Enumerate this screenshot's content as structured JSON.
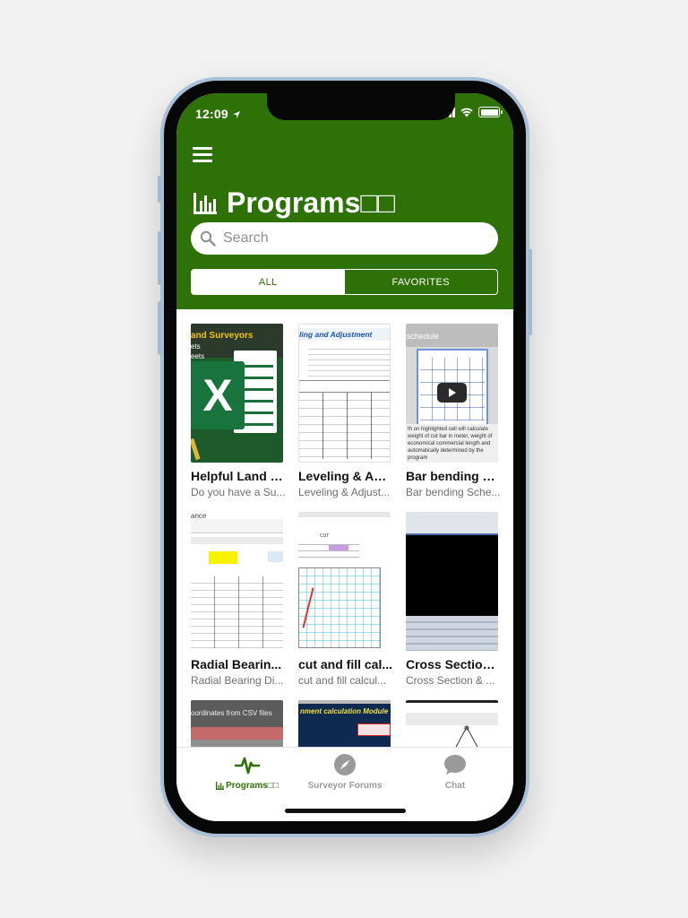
{
  "status": {
    "time": "12:09"
  },
  "header": {
    "title": "Programs□□",
    "search_placeholder": "Search",
    "segments": {
      "all": "ALL",
      "favorites": "FAVORITES"
    }
  },
  "cards": [
    {
      "title": "Helpful Land S...",
      "subtitle": "Do you have a Su...",
      "thumb_text": "and Surveyors"
    },
    {
      "title": "Leveling & Adj...",
      "subtitle": "Leveling & Adjust...",
      "thumb_text": "ling and Adjustment"
    },
    {
      "title": "Bar bending S...",
      "subtitle": "Bar bending Sche...",
      "thumb_text": "schedule"
    },
    {
      "title": "Radial Bearin...",
      "subtitle": "Radial Bearing Di...",
      "thumb_text": "ance"
    },
    {
      "title": "cut and fill cal...",
      "subtitle": "cut and fill calcul...",
      "thumb_text": "CUT"
    },
    {
      "title": "Cross Section ...",
      "subtitle": "Cross Section & ...",
      "thumb_text": ""
    },
    {
      "title": "",
      "subtitle": "",
      "thumb_text": "oordinates from CSV files"
    },
    {
      "title": "",
      "subtitle": "",
      "thumb_text": "nment calculation Module"
    },
    {
      "title": "",
      "subtitle": "",
      "thumb_text": ""
    }
  ],
  "tabbar": {
    "programs": "Programs□□",
    "forums": "Surveyor Forums",
    "chat": "Chat"
  },
  "colors": {
    "brand": "#2e7106",
    "inactive": "#9a9a9a"
  },
  "icons": {
    "menu": "hamburger-icon",
    "title": "bar-chart-icon",
    "search": "search-icon",
    "programs": "pulse-icon",
    "forums": "compass-icon",
    "chat": "chat-bubble-icon"
  }
}
